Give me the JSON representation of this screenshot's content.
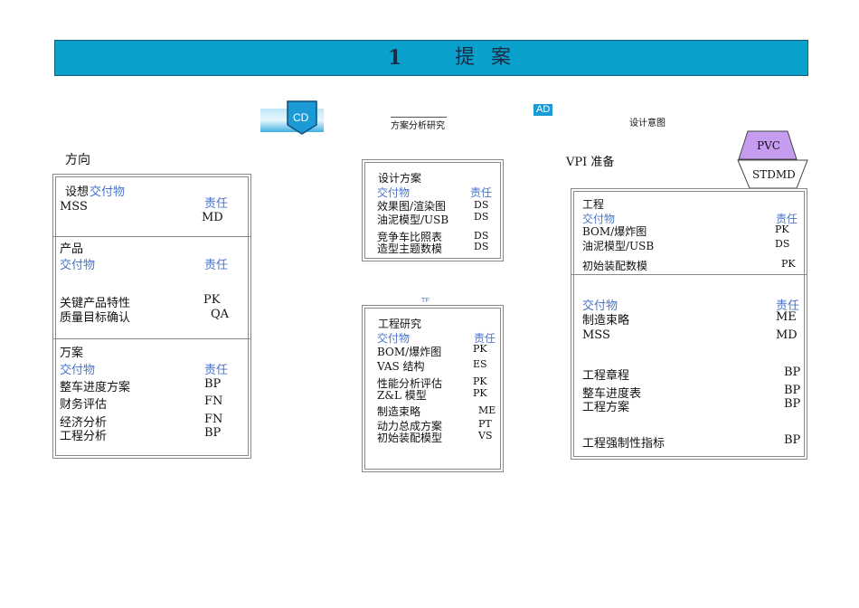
{
  "banner": {
    "number": "1",
    "title": "提案"
  },
  "top": {
    "cd": "CD",
    "scheme_research": "方案分析研究",
    "ad": "AD",
    "design_intent": "设计意图",
    "tf": "TF",
    "pvc": "PVC",
    "stdmd": "STDMD"
  },
  "left": {
    "title": "方向",
    "s1": {
      "head_pre": "设想",
      "head_blue": "交付物",
      "resp": "责任",
      "rows": [
        {
          "item": "MSS",
          "code": "MD"
        }
      ]
    },
    "s2": {
      "title": "产品",
      "deliv": "交付物",
      "resp": "责任",
      "rows": [
        {
          "item": "关键产品特性",
          "code": "PK"
        },
        {
          "item": "质量目标确认",
          "code": "QA"
        }
      ]
    },
    "s3": {
      "title": "万案",
      "deliv": "交付物",
      "resp": "责任",
      "rows": [
        {
          "item": "整车进度方案",
          "code": "BP"
        },
        {
          "item": "财务评估",
          "code": "FN"
        },
        {
          "item": "经济分析",
          "code": "FN"
        },
        {
          "item": "工程分析",
          "code": "BP"
        }
      ]
    }
  },
  "mid1": {
    "title": "设计方案",
    "deliv": "交付物",
    "resp": "责任",
    "rows": [
      {
        "item": "效果图/渲染图",
        "code": "DS"
      },
      {
        "item": "油泥模型/USB",
        "code": "DS"
      },
      {
        "item": "竞争车比照表",
        "code": "DS"
      },
      {
        "item": "造型主题数模",
        "code": "DS"
      }
    ]
  },
  "mid2": {
    "title": "工程研究",
    "deliv": "交付物",
    "resp": "责任",
    "rows": [
      {
        "item": "BOM/爆炸图",
        "code": "PK"
      },
      {
        "item": "VAS 结构",
        "code": "ES"
      },
      {
        "item": "性能分析评估",
        "code": "PK"
      },
      {
        "item": "Z&L 模型",
        "code": "PK"
      },
      {
        "item": "制造束略",
        "code": "ME"
      },
      {
        "item": "动力总成方案",
        "code": "PT"
      },
      {
        "item": "初始装配模型",
        "code": "VS"
      }
    ]
  },
  "right": {
    "title": "VPI 准备",
    "s1": {
      "title": "工程",
      "deliv": "交付物",
      "resp": "责任",
      "rows": [
        {
          "item": "BOM/爆炸图",
          "code": "PK"
        },
        {
          "item": "油泥模型/USB",
          "code": "DS"
        },
        {
          "item": "初始装配数模",
          "code": "PK"
        }
      ]
    },
    "s2": {
      "deliv": "交付物",
      "resp": "责任",
      "rows": [
        {
          "item": "制造束略",
          "code": "ME"
        },
        {
          "item": "MSS",
          "code": "MD"
        },
        {
          "item": "工程章程",
          "code": "BP"
        },
        {
          "item": "整车进度表",
          "code": "BP"
        },
        {
          "item": "工程方案",
          "code": "BP"
        },
        {
          "item": "工程强制性指标",
          "code": "BP"
        }
      ]
    }
  }
}
